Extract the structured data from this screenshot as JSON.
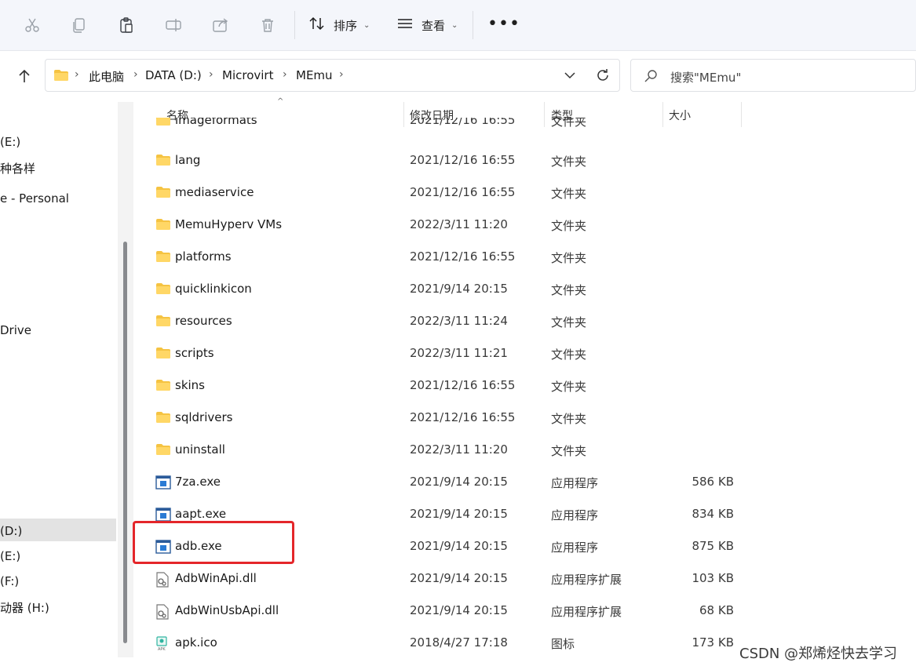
{
  "toolbar": {
    "cut_icon": "scissors-icon",
    "copy_icon": "copy-icon",
    "paste_icon": "paste-icon",
    "rename_icon": "rename-icon",
    "share_icon": "share-icon",
    "delete_icon": "trash-icon",
    "sort_label": "排序",
    "view_label": "查看",
    "more_label": "•••"
  },
  "address": {
    "crumbs": [
      "此电脑",
      "DATA (D:)",
      "Microvirt",
      "MEmu"
    ]
  },
  "search": {
    "placeholder": "搜索\"MEmu\""
  },
  "nav": {
    "items": [
      "(E:)",
      "种各样",
      "e - Personal",
      "Drive",
      "(D:)",
      "(E:)",
      "(F:)",
      "动器 (H:)"
    ]
  },
  "columns": {
    "name": "名称",
    "date": "修改日期",
    "type": "类型",
    "size": "大小"
  },
  "partial_row": {
    "name": "imageformats",
    "date": "2021/12/16 16:55",
    "type": "文件夹",
    "size": ""
  },
  "files": [
    {
      "name": "lang",
      "date": "2021/12/16 16:55",
      "type": "文件夹",
      "size": "",
      "icon": "folder-icon"
    },
    {
      "name": "mediaservice",
      "date": "2021/12/16 16:55",
      "type": "文件夹",
      "size": "",
      "icon": "folder-icon"
    },
    {
      "name": "MemuHyperv VMs",
      "date": "2022/3/11 11:20",
      "type": "文件夹",
      "size": "",
      "icon": "folder-icon"
    },
    {
      "name": "platforms",
      "date": "2021/12/16 16:55",
      "type": "文件夹",
      "size": "",
      "icon": "folder-icon"
    },
    {
      "name": "quicklinkicon",
      "date": "2021/9/14 20:15",
      "type": "文件夹",
      "size": "",
      "icon": "folder-icon"
    },
    {
      "name": "resources",
      "date": "2022/3/11 11:24",
      "type": "文件夹",
      "size": "",
      "icon": "folder-icon"
    },
    {
      "name": "scripts",
      "date": "2022/3/11 11:21",
      "type": "文件夹",
      "size": "",
      "icon": "folder-icon"
    },
    {
      "name": "skins",
      "date": "2021/12/16 16:55",
      "type": "文件夹",
      "size": "",
      "icon": "folder-icon"
    },
    {
      "name": "sqldrivers",
      "date": "2021/12/16 16:55",
      "type": "文件夹",
      "size": "",
      "icon": "folder-icon"
    },
    {
      "name": "uninstall",
      "date": "2022/3/11 11:20",
      "type": "文件夹",
      "size": "",
      "icon": "folder-icon"
    },
    {
      "name": "7za.exe",
      "date": "2021/9/14 20:15",
      "type": "应用程序",
      "size": "586 KB",
      "icon": "exe-icon"
    },
    {
      "name": "aapt.exe",
      "date": "2021/9/14 20:15",
      "type": "应用程序",
      "size": "834 KB",
      "icon": "exe-icon"
    },
    {
      "name": "adb.exe",
      "date": "2021/9/14 20:15",
      "type": "应用程序",
      "size": "875 KB",
      "icon": "exe-icon"
    },
    {
      "name": "AdbWinApi.dll",
      "date": "2021/9/14 20:15",
      "type": "应用程序扩展",
      "size": "103 KB",
      "icon": "dll-icon"
    },
    {
      "name": "AdbWinUsbApi.dll",
      "date": "2021/9/14 20:15",
      "type": "应用程序扩展",
      "size": "68 KB",
      "icon": "dll-icon"
    },
    {
      "name": "apk.ico",
      "date": "2018/4/27 17:18",
      "type": "图标",
      "size": "173 KB",
      "icon": "ico-file-icon"
    }
  ],
  "highlighted_file": "adb.exe",
  "highlight_color": "#e4262a",
  "folder_color": "#f5c342",
  "watermark": "CSDN @郑烯烃快去学习"
}
